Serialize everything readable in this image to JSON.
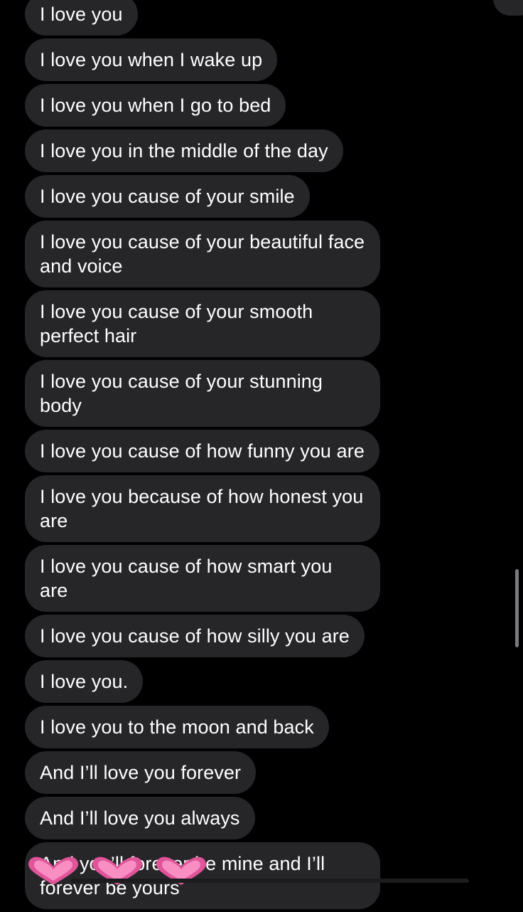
{
  "messages": [
    "I love you",
    "I love you when I wake up",
    "I love you when I go to bed",
    "I love you in the middle of the day",
    "I love you cause of your smile",
    "I love you cause of your beautiful face and voice",
    "I love you cause of your smooth perfect hair",
    "I love you cause of your stunning body",
    "I love you cause of how funny you are",
    "I love you because of how honest you are",
    "I love you cause of how smart you are",
    "I love you cause of how silly you are",
    "I love you.",
    "I love you to the moon and back",
    "And I’ll love you forever",
    "And I’ll love you always",
    "And you’ll forever be mine and I’ll forever be yours"
  ],
  "reaction": {
    "icon": "pink-heart-icon",
    "count": 3,
    "color": "#e0559a"
  },
  "colors": {
    "background": "#000000",
    "bubble": "#262629",
    "text": "#ffffff"
  }
}
